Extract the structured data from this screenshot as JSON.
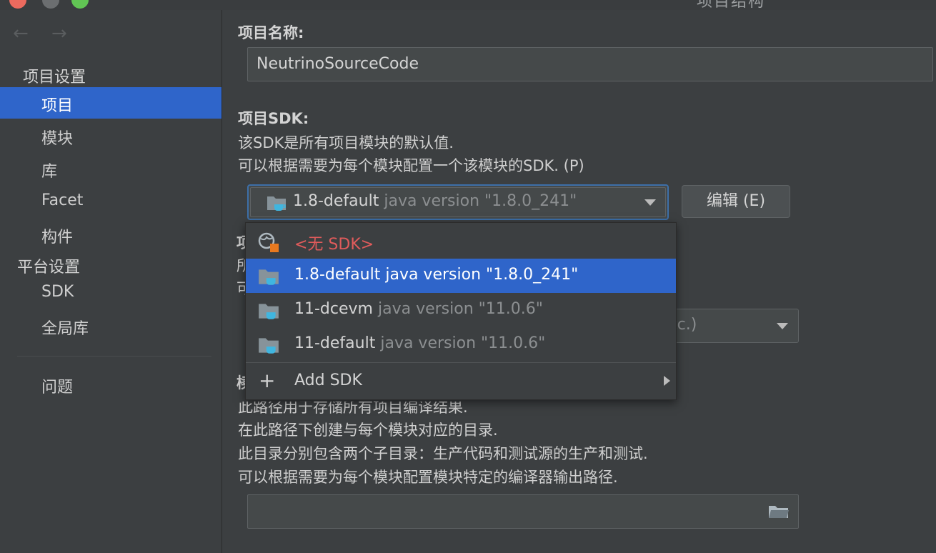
{
  "window": {
    "title": "项目结构"
  },
  "sidebar": {
    "project_settings_header": "项目设置",
    "platform_settings_header": "平台设置",
    "items": [
      {
        "label": "项目"
      },
      {
        "label": "模块"
      },
      {
        "label": "库"
      },
      {
        "label": "Facet"
      },
      {
        "label": "构件"
      },
      {
        "label": "SDK"
      },
      {
        "label": "全局库"
      },
      {
        "label": "问题"
      }
    ]
  },
  "project": {
    "name_label": "项目名称:",
    "name_value": "NeutrinoSourceCode",
    "sdk_label": "项目SDK:",
    "sdk_desc1": "该SDK是所有项目模块的默认值.",
    "sdk_desc2": "可以根据需要为每个模块配置一个该模块的SDK. (P)",
    "sdk_selected_name": "1.8-default",
    "sdk_selected_version": "java version \"1.8.0_241\"",
    "edit_button": "编辑 (E)",
    "hidden_label_1": "项",
    "hidden_label_2": "所",
    "hidden_label_3": "可",
    "level_combo_text": "tc.)",
    "hidden_label_4": "椟",
    "output_desc1": "此路径用于存储所有项目编译结果.",
    "output_desc2": "在此路径下创建与每个模块对应的目录.",
    "output_desc3": "此目录分别包含两个子目录：生产代码和测试源的生产和测试.",
    "output_desc4": "可以根据需要为每个模块配置模块特定的编译器输出路径.",
    "output_path_value": ""
  },
  "sdk_popup": {
    "items": [
      {
        "name": "<无 SDK>",
        "version": "",
        "icon": "globe-nosdk-icon"
      },
      {
        "name": "1.8-default",
        "version": "java version \"1.8.0_241\"",
        "icon": "jdk-folder-icon",
        "selected": true
      },
      {
        "name": "11-dcevm",
        "version": "java version \"11.0.6\"",
        "icon": "jdk-folder-icon"
      },
      {
        "name": "11-default",
        "version": "java version \"11.0.6\"",
        "icon": "jdk-folder-icon"
      }
    ],
    "add_sdk": "Add SDK"
  },
  "colors": {
    "accent": "#2f65ca",
    "background": "#3c3f41",
    "error_text": "#e05b5b"
  }
}
